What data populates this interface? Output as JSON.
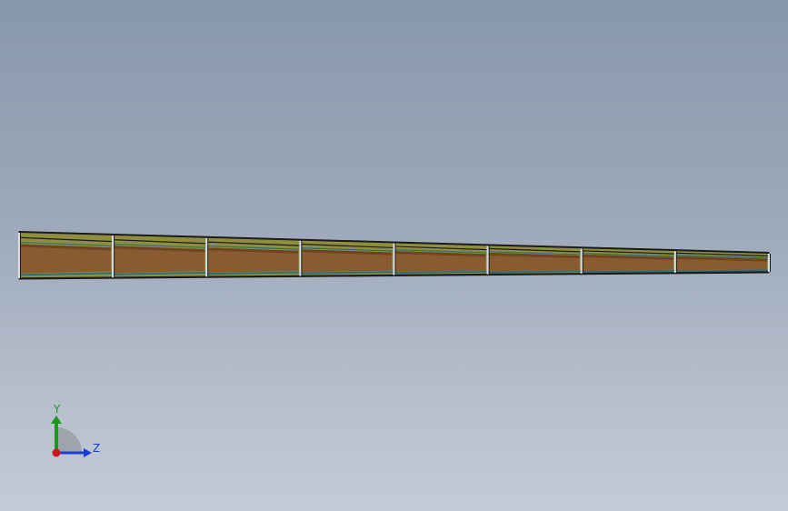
{
  "viewport": {
    "background_top": "#8797ab",
    "background_bottom": "#c4cbd6"
  },
  "model": {
    "segment_count": 8,
    "colors": {
      "core": "#8a5a30",
      "core_dark": "#6e4422",
      "skin": "#8f8e3e",
      "rail": "#2e6f7a",
      "edge": "#1b1b1b",
      "joint": "#d8dce2"
    }
  },
  "triad": {
    "y_label": "Y",
    "z_label": "Z",
    "y_color": "#1a9a1a",
    "z_color": "#1a3fd0",
    "x_color": "#c81818",
    "y_icon": "y-axis-arrow-icon",
    "z_icon": "z-axis-arrow-icon",
    "origin_icon": "x-axis-origin-icon"
  }
}
